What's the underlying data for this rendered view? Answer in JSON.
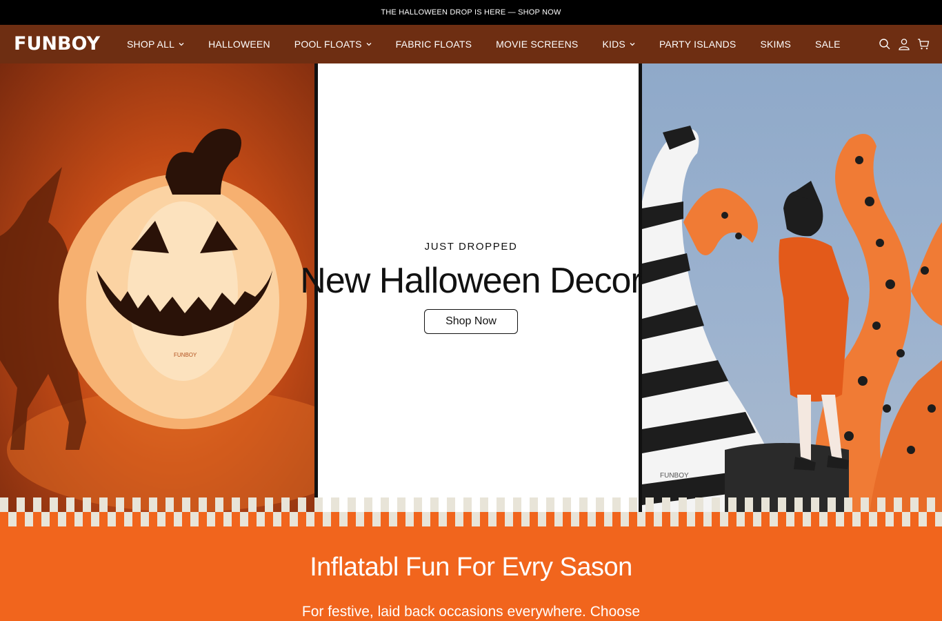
{
  "announcement": {
    "text": "THE HALLOWEEN DROP IS HERE — SHOP NOW"
  },
  "header": {
    "logo": "FUNBOY",
    "nav": [
      {
        "label": "SHOP ALL",
        "has_dropdown": true
      },
      {
        "label": "HALLOWEEN",
        "has_dropdown": false
      },
      {
        "label": "POOL FLOATS",
        "has_dropdown": true
      },
      {
        "label": "FABRIC FLOATS",
        "has_dropdown": false
      },
      {
        "label": "MOVIE SCREENS",
        "has_dropdown": false
      },
      {
        "label": "KIDS",
        "has_dropdown": true
      },
      {
        "label": "PARTY ISLANDS",
        "has_dropdown": false
      },
      {
        "label": "SKIMS",
        "has_dropdown": false
      },
      {
        "label": "SALE",
        "has_dropdown": false
      }
    ],
    "icons": [
      "search-icon",
      "account-icon",
      "cart-icon"
    ]
  },
  "hero": {
    "eyebrow": "JUST DROPPED",
    "title": "New Halloween Decor",
    "button": "Shop Now",
    "left_brand_mark": "FUNBOY",
    "right_brand_mark": "FUNBOY"
  },
  "season": {
    "title": "Inflatabl Fun For Evry Sason",
    "subtitle": "For festive, laid back occasions everywhere. Choose"
  },
  "colors": {
    "announcement_bg": "#000000",
    "header_bg": "#6e2e12",
    "season_bg": "#f1651d",
    "checker_light": "#e8e4d8"
  }
}
